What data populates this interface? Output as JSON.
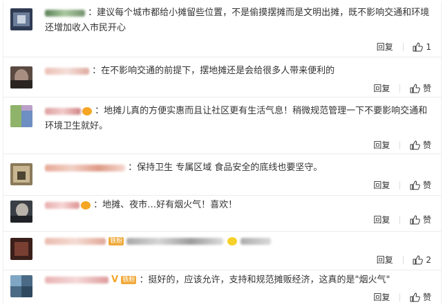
{
  "comments": [
    {
      "text": "：建议每个城市都给小摊留些位置，不是偷摸摆摊而是文明出摊，既不影响交通和环境还增加收入市民开心",
      "reply_label": "回复",
      "like_label": "1"
    },
    {
      "text": "：在不影响交通的前提下，摆地摊还是会给很多人带来便利的",
      "reply_label": "回复",
      "like_label": "赞"
    },
    {
      "text": "：地摊儿真的方便实惠而且让社区更有生活气息！稍微规范管理一下不要影响交通和环境卫生就好。",
      "reply_label": "回复",
      "like_label": "赞"
    },
    {
      "text": "：保持卫生 专属区域 食品安全的底线也要坚守。",
      "reply_label": "回复",
      "like_label": "赞"
    },
    {
      "text": "：地摊、夜市…好有烟火气！喜欢！",
      "reply_label": "回复",
      "like_label": "赞"
    },
    {
      "text": "",
      "tag": "铁粉",
      "reply_label": "回复",
      "like_label": "2"
    },
    {
      "text": "：挺好的，应该允许，支持和规范摊贩经济，这真的是\"烟火气\"",
      "tag": "铁粉",
      "vmark": "V",
      "reply_label": "回复",
      "like_label": "赞"
    }
  ],
  "colors": {
    "accent": "#f5a623",
    "text": "#333333",
    "divider": "#ececec"
  }
}
